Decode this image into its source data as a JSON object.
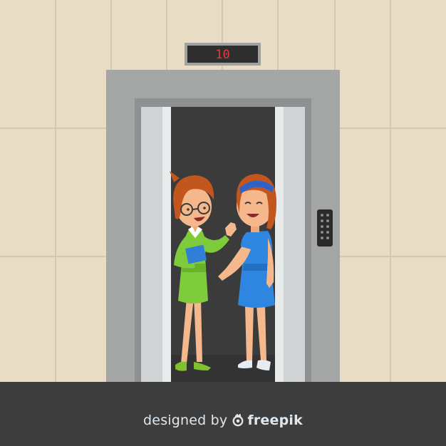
{
  "floor_display": {
    "value": "10"
  },
  "credit": {
    "prefix": "designed by",
    "brand": "freepik"
  },
  "colors": {
    "wall": "#e9dcc5",
    "wall_lines": "#d8c7ad",
    "floor": "#3d3d3d",
    "frame": "#a4a6a6",
    "door": "#cfd3d4",
    "cabin": "#3b3b3b",
    "display_digits": "#e8383d"
  },
  "icons": {
    "elevator_panel": "call-button-panel-icon",
    "credit_logo": "freepik-logo-icon"
  }
}
